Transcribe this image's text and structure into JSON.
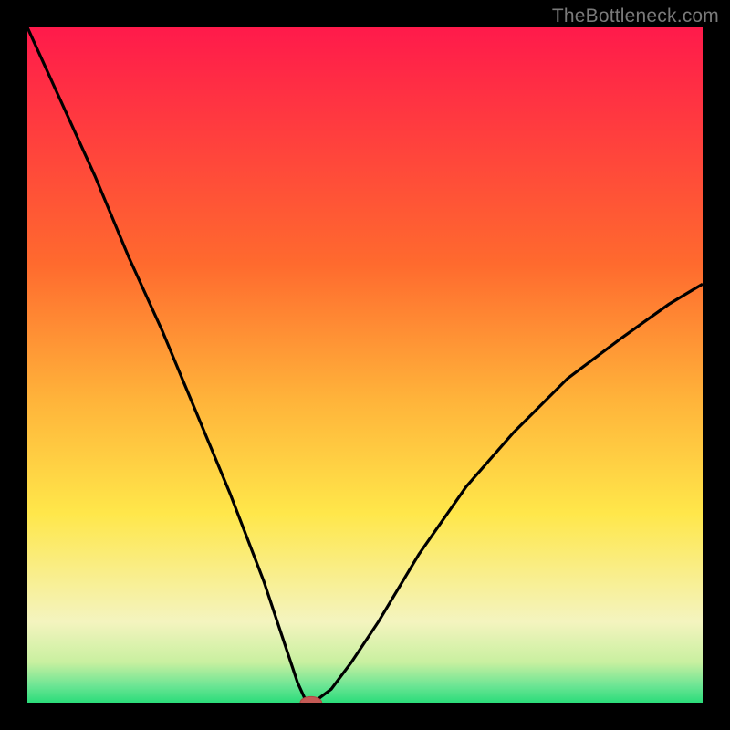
{
  "watermark": "TheBottleneck.com",
  "colors": {
    "page_bg": "#000000",
    "gradient_top": "#ff1a4b",
    "gradient_orange": "#ff8a2a",
    "gradient_yellow": "#ffe74a",
    "gradient_pale": "#f7f7c0",
    "gradient_green": "#2bdc7a",
    "curve_stroke": "#000000",
    "marker_fill": "#c45a55",
    "marker_stroke": "#b04843",
    "watermark_text": "#7a7a7a"
  },
  "chart_data": {
    "type": "line",
    "title": "",
    "xlabel": "",
    "ylabel": "",
    "xlim": [
      0,
      100
    ],
    "ylim": [
      0,
      100
    ],
    "x": [
      0,
      5,
      10,
      15,
      20,
      25,
      30,
      35,
      38,
      40,
      41,
      42,
      43,
      45,
      48,
      52,
      58,
      65,
      72,
      80,
      88,
      95,
      100
    ],
    "values": [
      100,
      89,
      78,
      66,
      55,
      43,
      31,
      18,
      9,
      3,
      0.8,
      0,
      0.5,
      2,
      6,
      12,
      22,
      32,
      40,
      48,
      54,
      59,
      62
    ],
    "marker": {
      "x": 42,
      "y": 0,
      "rx": 1.6,
      "ry": 0.9
    },
    "gradient_stops": [
      {
        "offset": 0.0,
        "color": "#ff1a4b"
      },
      {
        "offset": 0.35,
        "color": "#ff6a2e"
      },
      {
        "offset": 0.55,
        "color": "#ffb33a"
      },
      {
        "offset": 0.72,
        "color": "#ffe74a"
      },
      {
        "offset": 0.88,
        "color": "#f4f4bf"
      },
      {
        "offset": 0.94,
        "color": "#c9f0a0"
      },
      {
        "offset": 0.975,
        "color": "#6ce594"
      },
      {
        "offset": 1.0,
        "color": "#2bdc7a"
      }
    ]
  }
}
